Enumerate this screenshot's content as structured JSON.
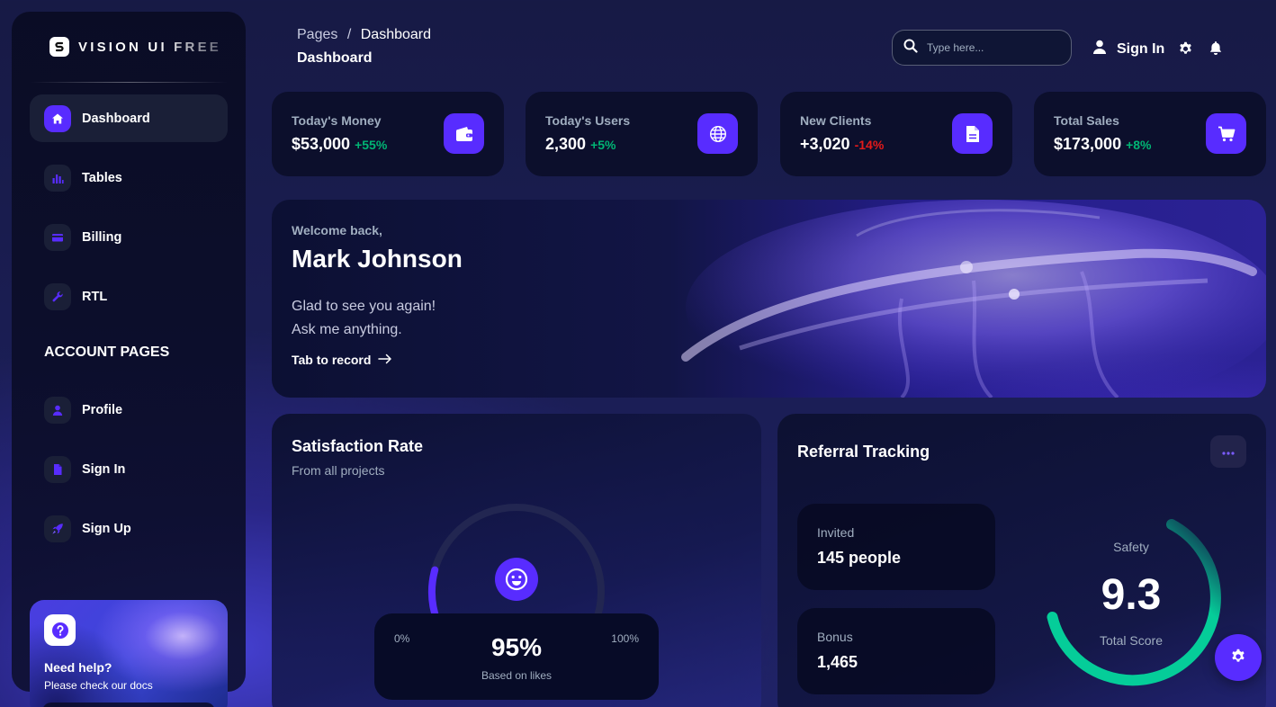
{
  "brand": {
    "name": "VISION UI FREE"
  },
  "sidebar": {
    "items": [
      {
        "label": "Dashboard",
        "icon": "home-icon",
        "active": true
      },
      {
        "label": "Tables",
        "icon": "bar-chart-icon"
      },
      {
        "label": "Billing",
        "icon": "credit-card-icon"
      },
      {
        "label": "RTL",
        "icon": "wrench-icon"
      }
    ],
    "section_title": "ACCOUNT PAGES",
    "account_items": [
      {
        "label": "Profile",
        "icon": "person-icon"
      },
      {
        "label": "Sign In",
        "icon": "document-icon"
      },
      {
        "label": "Sign Up",
        "icon": "rocket-icon"
      }
    ],
    "help": {
      "title": "Need help?",
      "subtitle": "Please check our docs",
      "icon": "question-icon"
    }
  },
  "header": {
    "breadcrumb_root": "Pages",
    "breadcrumb_sep": "/",
    "breadcrumb_current": "Dashboard",
    "title": "Dashboard",
    "search_placeholder": "Type here...",
    "signin_label": "Sign In"
  },
  "stats": [
    {
      "label": "Today's Money",
      "value": "$53,000",
      "change": "+55%",
      "trend": "up",
      "icon": "wallet-icon"
    },
    {
      "label": "Today's Users",
      "value": "2,300",
      "change": "+5%",
      "trend": "up",
      "icon": "globe-icon"
    },
    {
      "label": "New Clients",
      "value": "+3,020",
      "change": "-14%",
      "trend": "down",
      "icon": "document-icon"
    },
    {
      "label": "Total Sales",
      "value": "$173,000",
      "change": "+8%",
      "trend": "up",
      "icon": "cart-icon"
    }
  ],
  "welcome": {
    "greeting": "Welcome back,",
    "name": "Mark Johnson",
    "line1": "Glad to see you again!",
    "line2": "Ask me anything.",
    "link": "Tab to record"
  },
  "satisfaction": {
    "title": "Satisfaction Rate",
    "subtitle": "From all projects",
    "min_label": "0%",
    "max_label": "100%",
    "value_label": "95%",
    "value": 95,
    "note": "Based on likes",
    "icon": "smiley-icon"
  },
  "referral": {
    "title": "Referral Tracking",
    "invited_label": "Invited",
    "invited_value": "145 people",
    "bonus_label": "Bonus",
    "bonus_value": "1,465",
    "safety_label": "Safety",
    "score": "9.3",
    "score_label": "Total Score"
  },
  "colors": {
    "accent": "#582cff",
    "positive": "#01b574",
    "negative": "#e31a1a",
    "gauge_teal": "#05cd99",
    "muted": "#a0aec0"
  }
}
